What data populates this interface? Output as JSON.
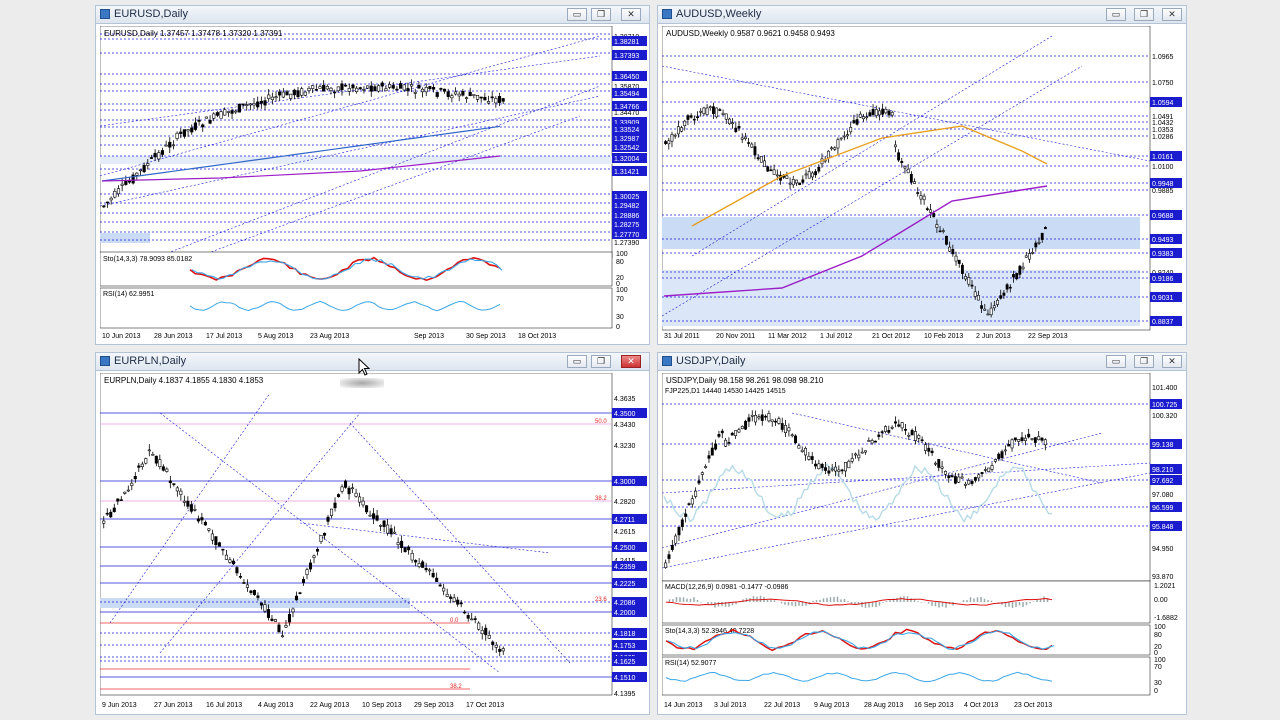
{
  "windows": [
    {
      "id": "eurusd",
      "title": "EURUSD,Daily",
      "info": "EURUSD,Daily  1.37457 1.37478 1.37320 1.37391",
      "prices": [
        "1.38710",
        "1.38281",
        "1.37393",
        "1.36450",
        "1.35870",
        "1.35494",
        "1.34766",
        "1.34470",
        "1.33909",
        "1.33524",
        "1.32987",
        "1.32542",
        "1.32004",
        "1.31421",
        "1.30025",
        "1.29482",
        "1.28886",
        "1.28275",
        "1.27770",
        "1.27390"
      ],
      "dates": [
        "10 Jun 2013",
        "28 Jun 2013",
        "17 Jul 2013",
        "5 Aug 2013",
        "23 Aug 2013",
        "",
        "Sep 2013",
        "30 Sep 2013",
        "18 Oct 2013"
      ],
      "sto_label": "Sto(14,3,3) 78.9093 85.0182",
      "sto_scale": [
        "100",
        "80",
        "20",
        "0"
      ],
      "rsi_label": "RSI(14) 62.9951",
      "rsi_scale": [
        "100",
        "70",
        "30",
        "0"
      ]
    },
    {
      "id": "audusd",
      "title": "AUDUSD,Weekly",
      "info": "AUDUSD,Weekly  0.9587 0.9621 0.9458 0.9493",
      "prices": [
        "1.0965",
        "1.0750",
        "1.0594",
        "1.0491",
        "1.0432",
        "1.0353",
        "1.0286",
        "1.0161",
        "1.0100",
        "0.9948",
        "0.9885",
        "0.9688",
        "0.9493",
        "0.9383",
        "0.9240",
        "0.9186",
        "0.9031",
        "0.8837"
      ],
      "dates": [
        "31 Jul 2011",
        "20 Nov 2011",
        "11 Mar 2012",
        "1 Jul 2012",
        "21 Oct 2012",
        "10 Feb 2013",
        "2 Jun 2013",
        "22 Sep 2013"
      ]
    },
    {
      "id": "eurpln",
      "title": "EURPLN,Daily",
      "info": "EURPLN,Daily  4.1837 4.1855 4.1830 4.1853",
      "prices": [
        "4.3635",
        "4.3500",
        "4.3430",
        "4.3230",
        "4.3000",
        "4.2820",
        "4.2711",
        "4.2615",
        "4.2500",
        "4.2415",
        "4.2359",
        "4.2225",
        "4.2086",
        "4.2000",
        "4.1818",
        "4.1753",
        "4.1665",
        "4.1625",
        "4.1510",
        "4.1395"
      ],
      "fib": [
        "50.0",
        "38.2",
        "23.6",
        "0.0",
        "38.2"
      ],
      "dates": [
        "9 Jun 2013",
        "27 Jun 2013",
        "16 Jul 2013",
        "4 Aug 2013",
        "22 Aug 2013",
        "10 Sep 2013",
        "29 Sep 2013",
        "17 Oct 2013"
      ]
    },
    {
      "id": "usdjpy",
      "title": "USDJPY,Daily",
      "info": "USDJPY,Daily  98.158 98.261 98.098 98.210",
      "overlay": "FJP225,D1  14440 14530 14425 14515",
      "prices": [
        "101.400",
        "100.725",
        "100.320",
        "99.138",
        "98.210",
        "97.692",
        "97.080",
        "96.599",
        "95.848",
        "94.950",
        "93.870"
      ],
      "dates": [
        "14 Jun 2013",
        "3 Jul 2013",
        "22 Jul 2013",
        "9 Aug 2013",
        "28 Aug 2013",
        "16 Sep 2013",
        "4 Oct 2013",
        "23 Oct 2013"
      ],
      "macd_label": "MACD(12,26,9) 0.0981 -0.1477 -0.0986",
      "macd_scale": [
        "1.2021",
        "0.00",
        "-1.6882"
      ],
      "sto_label": "Sto(14,3,3) 52.3946 40.7228",
      "sto_scale": [
        "100",
        "80",
        "20",
        "0"
      ],
      "rsi_label": "RSI(14) 52.9077",
      "rsi_scale": [
        "100",
        "70",
        "30",
        "0"
      ]
    }
  ],
  "colors": {
    "grid_blue": "#1b1bd6",
    "price_tag": "#1c1ccf",
    "ma_blue": "#3367c8",
    "ma_purple": "#9c1fc7",
    "ma_orange": "#e8a020",
    "sto_red": "#d11",
    "sto_blue": "#3aa6e6",
    "rsi_blue": "#3aa6e6",
    "zone": "#c9dbf5"
  },
  "buttons": {
    "minimize": "▭",
    "restore": "❐",
    "close": "✕"
  }
}
